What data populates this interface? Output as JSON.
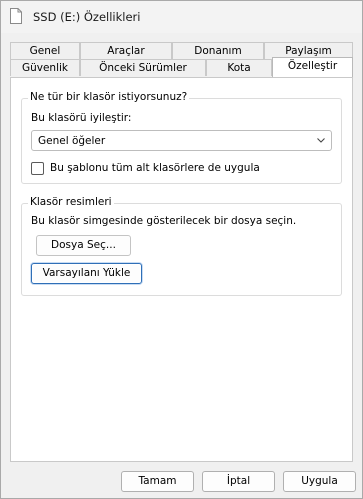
{
  "window": {
    "title": "SSD (E:) Özellikleri",
    "title_icon": "document-icon"
  },
  "tabs": {
    "row1": [
      "Genel",
      "Araçlar",
      "Donanım",
      "Paylaşım"
    ],
    "row2": [
      "Güvenlik",
      "Önceki Sürümler",
      "Kota",
      "Özelleştir"
    ],
    "active": "Özelleştir"
  },
  "optimize_group": {
    "legend": "Ne tür bir klasör istiyorsunuz?",
    "optimize_label": "Bu klasörü iyileştir:",
    "optimize_value": "Genel öğeler",
    "apply_template_label": "Bu şablonu tüm alt klasörlere de uygula",
    "apply_template_checked": false
  },
  "pictures_group": {
    "legend": "Klasör resimleri",
    "description": "Bu klasör simgesinde gösterilecek bir dosya seçin.",
    "choose_file_button": "Dosya Seç...",
    "restore_default_button": "Varsayılanı Yükle"
  },
  "footer": {
    "ok_button": "Tamam",
    "cancel_button": "İptal",
    "apply_button": "Uygula"
  },
  "colors": {
    "focus_border": "#2f6fb7",
    "panel_bg": "#ffffff",
    "dialog_bg": "#f0f0f0"
  }
}
